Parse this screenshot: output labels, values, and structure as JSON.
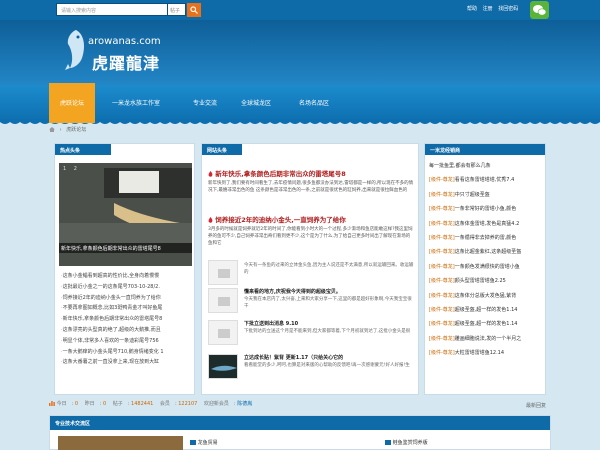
{
  "topbar": {
    "search_placeholder": "请输入搜索内容",
    "search_scope": "帖子",
    "links": [
      "帮助",
      "注册",
      "找回密码"
    ]
  },
  "logo": {
    "url": "arowanas.com",
    "title": "虎躍龍津"
  },
  "nav": {
    "home": "虎跃论坛",
    "items": [
      "一米龙水族工作室",
      "专业交流",
      "全球城龙区",
      "名场名品区"
    ]
  },
  "breadcrumb": {
    "home_icon": "home-icon",
    "separator": "›",
    "current": "虎跃论坛"
  },
  "left": {
    "title": "热点头条",
    "slide_nums": [
      "1",
      "2"
    ],
    "slide_caption": "新年快乐,拿条颜色后期非常出众的雷塔尾号8",
    "list": [
      "这条小金鲳看到超高的性价比,全身向着慢慢",
      "这批最近小金之一的这条尾号703-10-28/2.",
      "饲养接近2年的迪纳小金头一直饲养为了给你",
      "不要再拿图如概念,比如3斑鸭青金才叫好鱼尾",
      "新年快乐,拿条颜色后期非常出众的雷塔尾号8",
      "这条漂亮的头型真的绝了,超级的大鹅推,而且",
      "明显个体,非常多人喜欢的一条迪彩尾号756",
      "一条大鹅痒的小金头尾号710,鹅身情绪变化 1",
      "这条大番薯之前一直没拿上来,现在放到大缸"
    ]
  },
  "mid": {
    "title": "网站头条",
    "headline1": "新年快乐,拿条颜色后期非常出众的雷塔尾号8",
    "text1": "新年快到了,我们要有时间看生了,去年疫情问题,很多鱼都没办法到达,雷塔都是一样的,所以现在不多的情况下,最嬉非常出色的鱼 这条颜色是非常出色的一条,之前就是很优色的缸饲养,出来就是很拉鲜血色的",
    "headline2": "饲养接近2年的迪纳小金头,一直饲养为了给你",
    "text2": "3月多的时候就是饲养就近2年的时间了,你能看到小时大的一个过程,多少渐场和鱼店能敢这样?我这里饲养的鱼可不少,自己饲养非常出奇们看到更不少,这个是为了什么,为了给自己更多时间出了解现在渐场的鱼和它",
    "items": [
      {
        "title": "",
        "text": "今天有一条鱼的过来的立体金头鱼,因为主人说还是不太满意,所以就运输回来。收运输的"
      },
      {
        "title": "懂来看的地方,庆祝我今天得到的超级宝贝。",
        "text": "今天我在本店内了,太兴奋,上来和大家分享一下,这里的都是超好形象啊,今天我宝宝很干"
      },
      {
        "title": "下批立送到出消息 9.10",
        "text": "下批到达的立送这个月是不能来到,但大家都等着,下个月初就到达了,这批小金头是很"
      },
      {
        "title": "立达成长贴！紫背 更新1.17（只给关心它的",
        "text": "看看能堂的多少,呵呵,也算是对来版的心帮助的反馈吧!再一次感谢蒙元!好人好报!生"
      }
    ]
  },
  "right": {
    "title": "一米龙经销商",
    "list": [
      {
        "tag": "",
        "text": "每一批鱼里,都会有那么几条"
      },
      {
        "tag": "[级件-尊龙]",
        "text": "看看这条雷塔塔塔,优秀7.4"
      },
      {
        "tag": "[级件-尊龙]",
        "text": "中只寸超级圣盔"
      },
      {
        "tag": "[级件-尊龙]",
        "text": "一条非常好的雷塔小鱼,颜色"
      },
      {
        "tag": "[级件-尊龙]",
        "text": "这条体金雷塔,发色是真猛4.2"
      },
      {
        "tag": "[级件-尊龙]",
        "text": "一条循得非去掉养的雷,颜色"
      },
      {
        "tag": "[级件-尊龙]",
        "text": "这条比超金紫红,这条超级圣盔"
      },
      {
        "tag": "[级件-尊龙]",
        "text": "一条颜色发满很快的雷塔小鱼"
      },
      {
        "tag": "[级件-尊龙]",
        "text": "颜头型雷塔雷塔鱼2.25"
      },
      {
        "tag": "[级件-尊龙]",
        "text": "这条体分总版大发色猛,紫背"
      },
      {
        "tag": "[级件-尊龙]",
        "text": "超级圣盔,超一样的发色1.14"
      },
      {
        "tag": "[级件-尊龙]",
        "text": "超级圣盔,超一样的发色1.14"
      },
      {
        "tag": "[级件-尊龙]",
        "text": "雕画细胞说法,发的一个半月之"
      },
      {
        "tag": "[级件-尊龙]",
        "text": "大粒雷塔雷塔鱼12.14"
      }
    ]
  },
  "stats": {
    "today_label": "今日",
    "today": "0",
    "yesterday_label": "昨日",
    "yesterday": "0",
    "posts_label": "帖子",
    "posts": "1482441",
    "members_label": "会员",
    "members": "122107",
    "newest_label": "欢迎新会员",
    "newest": "陈德胤",
    "right": "最新回复"
  },
  "bottom": {
    "title": "专业技术交流区",
    "sub1": "龙鱼贸易",
    "sub2": "鲑鱼鉴赏饲养版"
  },
  "colors": {
    "primary": "#0f6aa8",
    "accent": "#f3a420",
    "headline": "#b01e1e",
    "tag": "#cc6600"
  }
}
